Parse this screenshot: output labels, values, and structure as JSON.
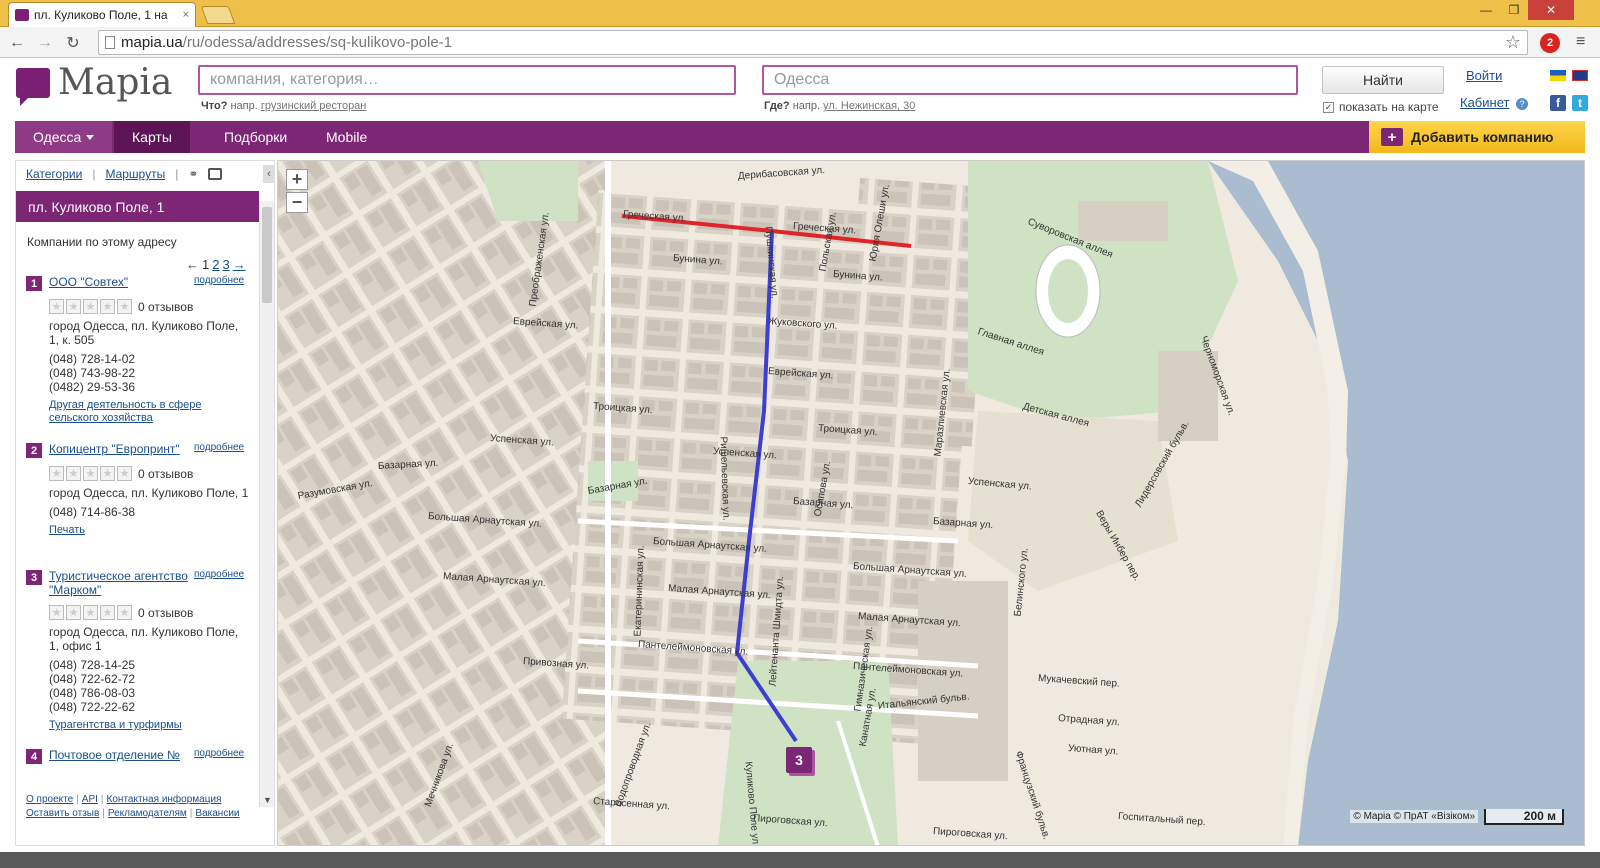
{
  "browser": {
    "tab_title": "пл. Куликово Поле, 1 на",
    "tab_close": "×",
    "url_host": "mapia.ua",
    "url_path": "/ru/odessa/addresses/sq-kulikovo-pole-1",
    "ext_badge": "2"
  },
  "header": {
    "logo_text": "Mapia",
    "what_placeholder": "компания, категория…",
    "where_placeholder": "Одесса",
    "what_hint_label": "Что?",
    "what_hint_prefix": "напр.",
    "what_hint_example": "грузинский ресторан",
    "where_hint_label": "Где?",
    "where_hint_prefix": "напр.",
    "where_hint_example": "ул. Нежинская, 30",
    "find_label": "Найти",
    "show_on_map": "показать на карте",
    "login": "Войти",
    "cabinet": "Кабинет"
  },
  "nav": {
    "city": "Одесса",
    "items": [
      "Карты",
      "Подборки",
      "Mobile"
    ],
    "add_company": "Добавить компанию"
  },
  "sidebar": {
    "tab_categories": "Категории",
    "tab_routes": "Маршруты",
    "address_title": "пл. Куликово Поле, 1",
    "companies_label": "Компании по этому адресу",
    "pager": {
      "prev": "←",
      "pages": [
        "1",
        "2",
        "3"
      ],
      "next": "→"
    },
    "more_label": "подробнее",
    "companies": [
      {
        "num": "1",
        "name": "ООО \"Совтех\"",
        "reviews": "0 отзывов",
        "address": "город Одесса, пл. Куликово Поле, 1, к. 505",
        "phones": [
          "(048) 728-14-02",
          "(048) 743-98-22",
          "(0482) 29-53-36"
        ],
        "category": "Другая деятельность в сфере сельского хозяйства"
      },
      {
        "num": "2",
        "name": "Копицентр \"Европринт\"",
        "reviews": "0 отзывов",
        "address": "город Одесса, пл. Куликово Поле, 1",
        "phones": [
          "(048) 714-86-38"
        ],
        "category": "Печать"
      },
      {
        "num": "3",
        "name": "Туристическое агентство \"Марком\"",
        "reviews": "0 отзывов",
        "address": "город Одесса, пл. Куликово Поле, 1, офис 1",
        "phones": [
          "(048) 728-14-25",
          "(048) 722-62-72",
          "(048) 786-08-03",
          "(048) 722-22-62"
        ],
        "category": "Турагентства и турфирмы"
      },
      {
        "num": "4",
        "name": "Почтовое отделение №",
        "reviews": "",
        "address": "",
        "phones": [],
        "category": ""
      }
    ],
    "footer": {
      "about": "О проекте",
      "api": "API",
      "contacts": "Контактная информация",
      "feedback": "Оставить отзыв",
      "advertisers": "Рекламодателям",
      "jobs": "Вакансии"
    }
  },
  "map": {
    "marker_count": "3",
    "copyright": "© Mapia © ПрАТ «Візіком»",
    "scale_label": "200 м",
    "streets": [
      "Дерибасовская ул.",
      "Греческая ул.",
      "Греческая ул.",
      "Бунина ул.",
      "Бунина ул.",
      "Жуковского ул.",
      "Еврейская ул.",
      "Еврейская ул.",
      "Троицкая ул.",
      "Троицкая ул.",
      "Успенская ул.",
      "Успенская ул.",
      "Успенская ул.",
      "Базарная ул.",
      "Базарная ул.",
      "Базарная ул.",
      "Базарная ул.",
      "Большая Арнаутская ул.",
      "Большая Арнаутская ул.",
      "Большая Арнаутская ул.",
      "Малая Арнаутская ул.",
      "Малая Арнаутская ул.",
      "Малая Арнаутская ул.",
      "Пантелеймоновская ул.",
      "Пантелеймоновская ул.",
      "Привозная ул.",
      "Итальянский бульв.",
      "Староcенная ул.",
      "Пироговская ул.",
      "Разумовская ул.",
      "Суворовская аллея",
      "Главная аллея",
      "Детская аллея",
      "Мукачевский пер.",
      "Отрадная ул.",
      "Уютная ул.",
      "Госпитальный пер.",
      "Пироговская ул.",
      "Куликово Поле ул.",
      "Пушкинская ул.",
      "Ришельевская ул.",
      "Екатерининская ул.",
      "Преображенская ул.",
      "Канатная ул.",
      "Маразлиевская ул.",
      "Лидерсовский бульв.",
      "Черноморская ул.",
      "Веры Инбер пер.",
      "Белинского ул.",
      "Французский бульв.",
      "Мечникова ул.",
      "Водопроводная ул.",
      "Лейтенанта Шмидта ул.",
      "Гимназическая ул.",
      "Осипова ул.",
      "Польская ул.",
      "Юрия Олеши ул."
    ]
  },
  "colors": {
    "brand_purple": "#7c2675",
    "accent_yellow": "#f2b81b",
    "route_red": "#e0242a",
    "route_blue": "#3c3fd0",
    "sea": "#a9bcd0",
    "park": "#cfe3c4"
  }
}
